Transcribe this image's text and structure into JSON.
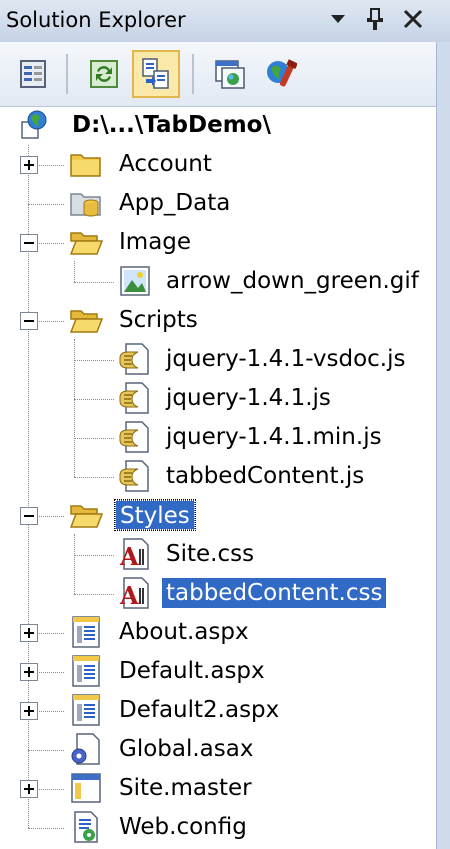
{
  "panel": {
    "title": "Solution Explorer",
    "buttons": [
      "dropdown-arrow-icon",
      "pin-icon",
      "close-icon"
    ]
  },
  "toolbar": {
    "tools": [
      {
        "name": "properties-button",
        "icon": "properties-icon"
      },
      {
        "name": "refresh-button",
        "icon": "refresh-icon"
      },
      {
        "name": "nest-related-files-button",
        "icon": "nest-files-icon",
        "active": true
      },
      {
        "name": "view-in-browser-button",
        "icon": "browser-view-icon"
      },
      {
        "name": "project-settings-button",
        "icon": "project-settings-icon"
      }
    ]
  },
  "tree": {
    "root": {
      "label": "D:\\...\\TabDemo\\",
      "icon": "website-globe-icon"
    },
    "items": [
      {
        "label": "Account",
        "icon": "folder-icon",
        "level": 1,
        "expander": "plus"
      },
      {
        "label": "App_Data",
        "icon": "data-folder-icon",
        "level": 1,
        "expander": "none"
      },
      {
        "label": "Image",
        "icon": "open-folder-icon",
        "level": 1,
        "expander": "minus"
      },
      {
        "label": "arrow_down_green.gif",
        "icon": "image-file-icon",
        "level": 2,
        "expander": "none"
      },
      {
        "label": "Scripts",
        "icon": "open-folder-icon",
        "level": 1,
        "expander": "minus"
      },
      {
        "label": "jquery-1.4.1-vsdoc.js",
        "icon": "script-file-icon",
        "level": 2,
        "expander": "none"
      },
      {
        "label": "jquery-1.4.1.js",
        "icon": "script-file-icon",
        "level": 2,
        "expander": "none"
      },
      {
        "label": "jquery-1.4.1.min.js",
        "icon": "script-file-icon",
        "level": 2,
        "expander": "none"
      },
      {
        "label": "tabbedContent.js",
        "icon": "script-file-icon",
        "level": 2,
        "expander": "none"
      },
      {
        "label": "Styles",
        "icon": "open-folder-icon",
        "level": 1,
        "expander": "minus",
        "state": "focused"
      },
      {
        "label": "Site.css",
        "icon": "css-file-icon",
        "level": 2,
        "expander": "none"
      },
      {
        "label": "tabbedContent.css",
        "icon": "css-file-icon",
        "level": 2,
        "expander": "none",
        "state": "selected"
      },
      {
        "label": "About.aspx",
        "icon": "aspx-page-icon",
        "level": 1,
        "expander": "plus"
      },
      {
        "label": "Default.aspx",
        "icon": "aspx-page-icon",
        "level": 1,
        "expander": "plus"
      },
      {
        "label": "Default2.aspx",
        "icon": "aspx-page-icon",
        "level": 1,
        "expander": "plus"
      },
      {
        "label": "Global.asax",
        "icon": "global-asax-icon",
        "level": 1,
        "expander": "none"
      },
      {
        "label": "Site.master",
        "icon": "master-page-icon",
        "level": 1,
        "expander": "plus"
      },
      {
        "label": "Web.config",
        "icon": "config-file-icon",
        "level": 1,
        "expander": "none"
      }
    ]
  },
  "colors": {
    "selection": "#316ac5",
    "titlebar": "#c6d3e6",
    "toolbar_active": "#fbe9a9",
    "folder": "#f2c84b"
  }
}
